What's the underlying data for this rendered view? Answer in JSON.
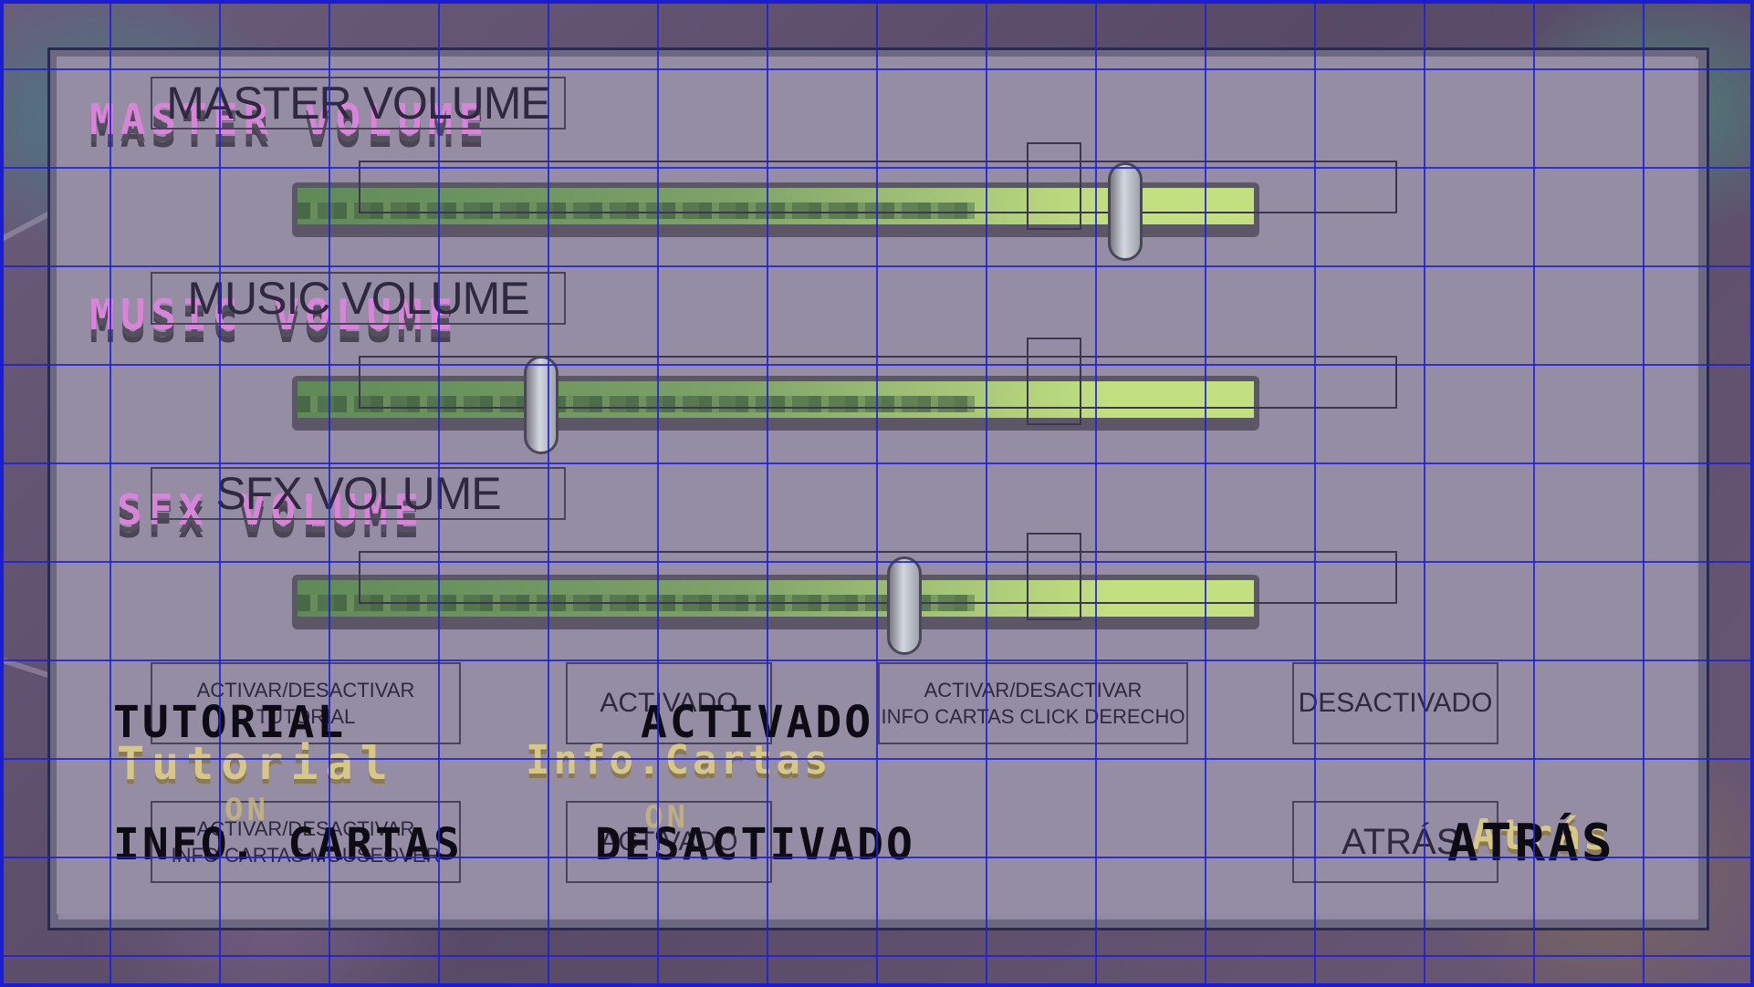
{
  "sliders": [
    {
      "box_label": "MASTER VOLUME",
      "pixel_label": "MASTER VOLUME",
      "level_percent": 80
    },
    {
      "box_label": "MUSIC VOLUME",
      "pixel_label": "MUSIC VOLUME",
      "level_percent": 26
    },
    {
      "box_label": "SFX VOLUME",
      "pixel_label": "SFX VOLUME",
      "level_percent": 63
    }
  ],
  "buttons": {
    "tutorial_toggle_line1": "ACTIVAR/DESACTIVAR",
    "tutorial_toggle_line2": "TUTORIAL",
    "tutorial_state": "ACTIVADO",
    "info_click_line1": "ACTIVAR/DESACTIVAR",
    "info_click_line2": "INFO CARTAS CLICK DERECHO",
    "info_click_state": "DESACTIVADO",
    "info_hover_line1": "ACTIVAR/DESACTIVAR",
    "info_hover_line2": "INFO CARTAS MOUSEOVER",
    "info_hover_state": "ACTIVADO",
    "back": "ATRÁS"
  },
  "pixel_overlay": {
    "tutorial": "TUTORIAL",
    "tutorial_state": "ACTIVADO",
    "tutorial_gold": "Tutorial",
    "tutorial_on": "ON",
    "info_gold": "Info.Cartas",
    "info_on": "ON",
    "info": "INFO. CARTAS",
    "info_state": "DESACTIVADO",
    "back": "ATRÁS",
    "back_gold": "Atrás"
  },
  "colors": {
    "panel": "#948da3",
    "track_fill": "#c2e080",
    "grid_lines": "#1e1edc",
    "pixel_title": "#d884d8"
  }
}
